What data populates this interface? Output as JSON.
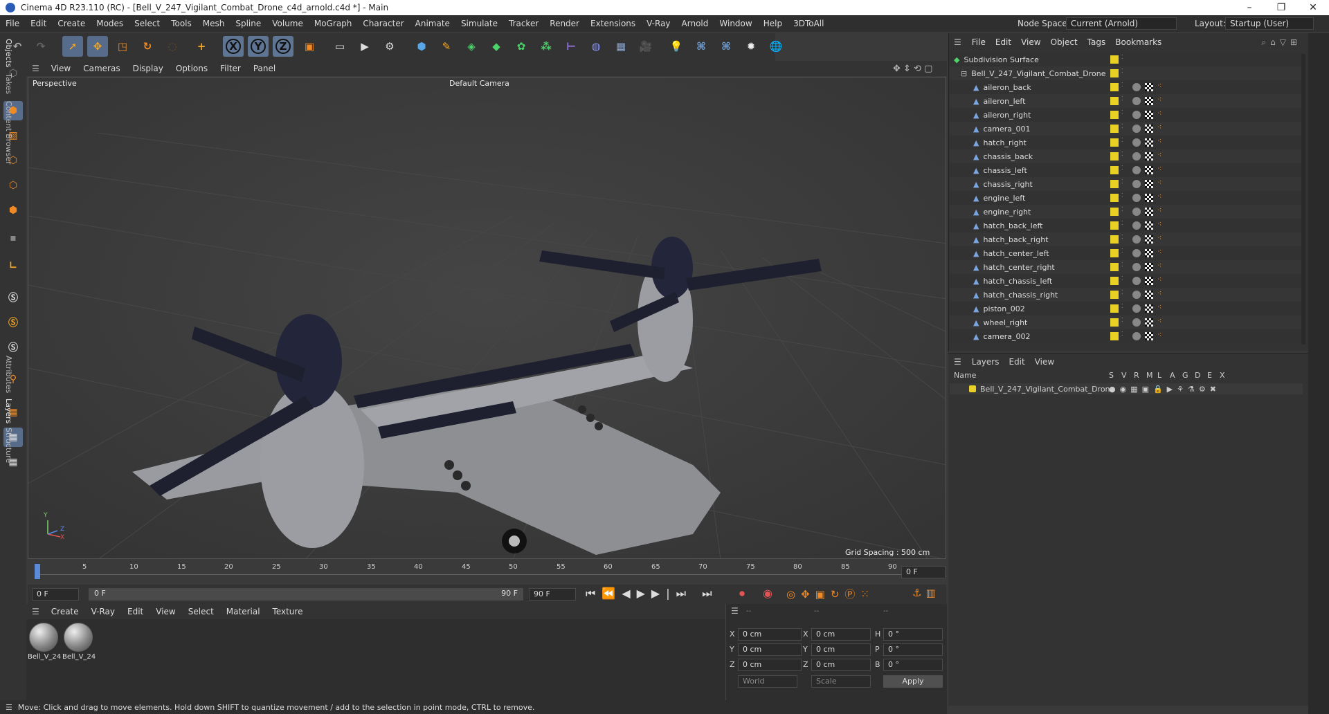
{
  "window": {
    "title": "Cinema 4D R23.110 (RC) - [Bell_V_247_Vigilant_Combat_Drone_c4d_arnold.c4d *] - Main",
    "min": "–",
    "max": "❐",
    "close": "✕"
  },
  "menubar": {
    "items": [
      "File",
      "Edit",
      "Create",
      "Modes",
      "Select",
      "Tools",
      "Mesh",
      "Spline",
      "Volume",
      "MoGraph",
      "Character",
      "Animate",
      "Simulate",
      "Tracker",
      "Render",
      "Extensions",
      "V-Ray",
      "Arnold",
      "Window",
      "Help",
      "3DToAll"
    ],
    "node_space_label": "Node Space:",
    "node_space_value": "Current (Arnold)",
    "layout_label": "Layout:",
    "layout_value": "Startup (User)"
  },
  "toolbar": {
    "x": "X",
    "y": "Y",
    "z": "Z"
  },
  "viewport": {
    "menu": [
      "View",
      "Cameras",
      "Display",
      "Options",
      "Filter",
      "Panel"
    ],
    "label": "Perspective",
    "camera": "Default Camera",
    "grid": "Grid Spacing : 500 cm",
    "axis_y": "Y",
    "axis_z": "Z",
    "axis_x": "X"
  },
  "timeline": {
    "ticks": [
      "0",
      "5",
      "10",
      "15",
      "20",
      "25",
      "30",
      "35",
      "40",
      "45",
      "50",
      "55",
      "60",
      "65",
      "70",
      "75",
      "80",
      "85",
      "90"
    ],
    "frame_right": "0 F"
  },
  "transport": {
    "start": "0 F",
    "slider_start": "0 F",
    "slider_end": "90 F",
    "end": "90 F"
  },
  "materials": {
    "menu": [
      "Create",
      "V-Ray",
      "Edit",
      "View",
      "Select",
      "Material",
      "Texture"
    ],
    "items": [
      "Bell_V_24",
      "Bell_V_24"
    ]
  },
  "coords": {
    "header": [
      "--",
      "--",
      "--"
    ],
    "rows": [
      {
        "a": "X",
        "av": "0 cm",
        "b": "X",
        "bv": "0 cm",
        "c": "H",
        "cv": "0 °"
      },
      {
        "a": "Y",
        "av": "0 cm",
        "b": "Y",
        "bv": "0 cm",
        "c": "P",
        "cv": "0 °"
      },
      {
        "a": "Z",
        "av": "0 cm",
        "b": "Z",
        "bv": "0 cm",
        "c": "B",
        "cv": "0 °"
      }
    ],
    "world": "World",
    "scale": "Scale",
    "apply": "Apply"
  },
  "status": "Move: Click and drag to move elements. Hold down SHIFT to quantize movement / add to the selection in point mode, CTRL to remove.",
  "objects": {
    "menu": [
      "File",
      "Edit",
      "View",
      "Object",
      "Tags",
      "Bookmarks"
    ],
    "root": "Subdivision Surface",
    "group": "Bell_V_247_Vigilant_Combat_Drone",
    "items": [
      "aileron_back",
      "aileron_left",
      "aileron_right",
      "camera_001",
      "hatch_right",
      "chassis_back",
      "chassis_left",
      "chassis_right",
      "engine_left",
      "engine_right",
      "hatch_back_left",
      "hatch_back_right",
      "hatch_center_left",
      "hatch_center_right",
      "hatch_chassis_left",
      "hatch_chassis_right",
      "piston_002",
      "wheel_right",
      "camera_002"
    ]
  },
  "layers": {
    "menu": [
      "Layers",
      "Edit",
      "View"
    ],
    "col_name": "Name",
    "cols": [
      "S",
      "V",
      "R",
      "M",
      "L",
      "A",
      "G",
      "D",
      "E",
      "X"
    ],
    "row": "Bell_V_247_Vigilant_Combat_Drone"
  },
  "right_tabs": [
    "Objects",
    "Takes",
    "Content Browser",
    "Attributes",
    "Layers",
    "Structure"
  ],
  "colors": {
    "accent": "#566c8a",
    "layer_yellow": "#e8d024"
  }
}
